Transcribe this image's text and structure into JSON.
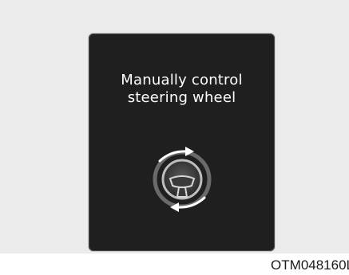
{
  "display": {
    "message_line1": "Manually control",
    "message_line2": "steering wheel",
    "icon": "steering-wheel-rotate-icon"
  },
  "figure": {
    "caption": "OTM048160L"
  },
  "colors": {
    "screen_background": "#1f1f1f",
    "page_background": "#ebebeb",
    "text": "#ffffff"
  }
}
